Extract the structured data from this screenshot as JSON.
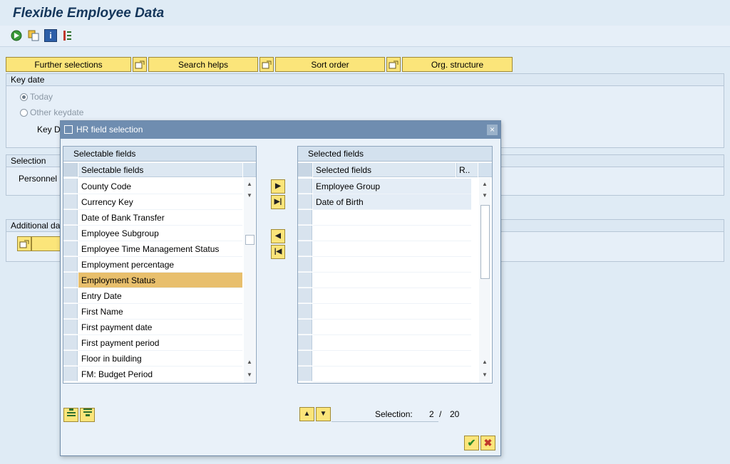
{
  "page": {
    "title": "Flexible Employee Data"
  },
  "toolbar": {
    "icons": [
      "execute-icon",
      "copy-icon",
      "info-icon",
      "list-icon"
    ],
    "info_glyph": "i"
  },
  "selection_buttons": {
    "further": "Further selections",
    "search_helps": "Search helps",
    "sort_order": "Sort order",
    "org_structure": "Org. structure"
  },
  "key_date": {
    "title": "Key date",
    "today": "Today",
    "other": "Other keydate",
    "key_date_label": "Key D"
  },
  "selection": {
    "title": "Selection",
    "personnel_label": "Personnel"
  },
  "additional": {
    "title": "Additional da"
  },
  "dialog": {
    "title": "HR field selection",
    "close": "×",
    "left": {
      "title": "Selectable fields",
      "column": "Selectable fields",
      "rows": [
        "County Code",
        "Currency Key",
        "Date of Bank Transfer",
        "Employee Subgroup",
        "Employee Time Management Status",
        "Employment percentage",
        "Employment Status",
        "Entry Date",
        "First Name",
        "First payment date",
        "First payment period",
        "Floor in building",
        "FM: Budget Period"
      ],
      "highlighted_index": 6
    },
    "right": {
      "title": "Selected fields",
      "column": "Selected fields",
      "column2": "R..",
      "rows": [
        "Employee Group",
        "Date of Birth"
      ]
    },
    "selection_label": "Selection:",
    "selection_count": "2",
    "selection_sep": "/",
    "selection_total": "20"
  },
  "colors": {
    "button_yellow": "#fbe57a",
    "highlight": "#e8bf6c",
    "title_blue": "#14365b",
    "dialog_bar": "#6f8db0"
  }
}
